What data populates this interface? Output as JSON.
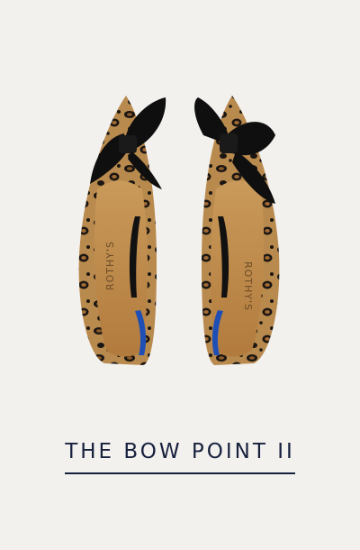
{
  "product": {
    "title": "THE BOW POINT II",
    "image_alt": "Leopard print pointed-toe knit flats with black bows",
    "insole_brand": "ROTHY'S",
    "colors": {
      "background": "#f3f1ee",
      "title": "#17203d",
      "leopard_base": "#b98a4e",
      "leopard_spot": "#1b1612",
      "bow": "#0f0f0f",
      "insole": "#c38c4b",
      "heel_accent": "#1f4fb5"
    }
  }
}
